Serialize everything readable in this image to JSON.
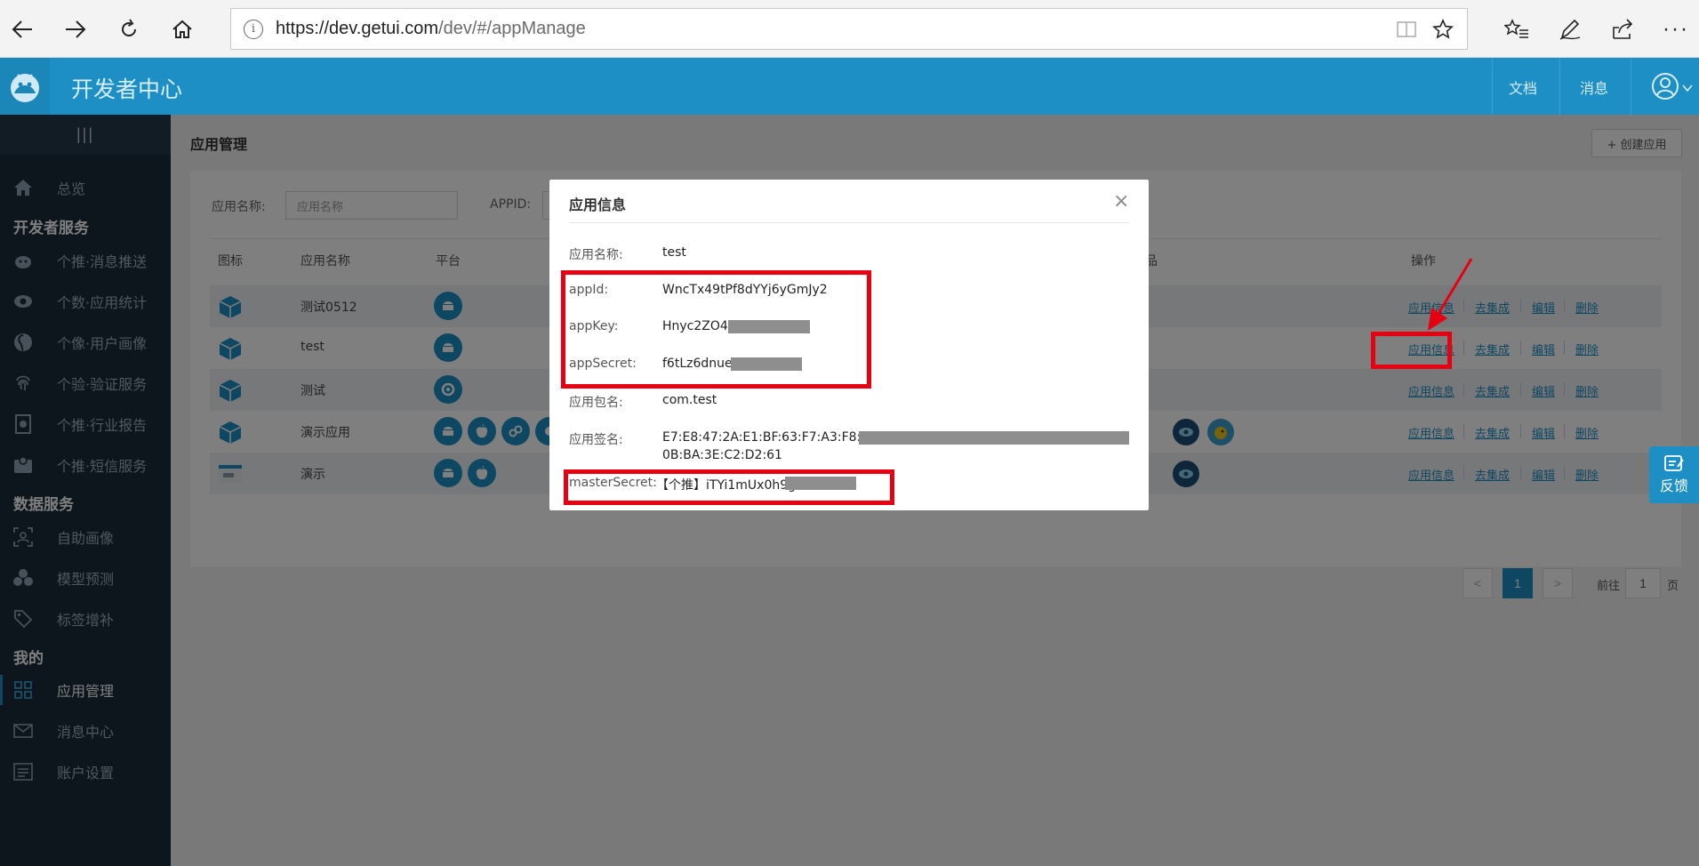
{
  "browser": {
    "url_host": "https://dev.getui.com",
    "url_path": "/dev/#/appManage"
  },
  "header": {
    "title": "开发者中心",
    "links": [
      "文档",
      "消息"
    ]
  },
  "sidebar": {
    "collapse_glyph": "|||",
    "sections": [
      "开发者服务",
      "数据服务",
      "我的"
    ],
    "items": [
      {
        "label": "总览",
        "icon": "home-icon"
      },
      {
        "label": "个推·消息推送",
        "icon": "push-icon"
      },
      {
        "label": "个数·应用统计",
        "icon": "eye-icon"
      },
      {
        "label": "个像·用户画像",
        "icon": "portrait-icon"
      },
      {
        "label": "个验·验证服务",
        "icon": "fingerprint-icon"
      },
      {
        "label": "个推·行业报告",
        "icon": "report-icon"
      },
      {
        "label": "个推·短信服务",
        "icon": "sms-icon"
      },
      {
        "label": "自助画像",
        "icon": "user-scan-icon"
      },
      {
        "label": "模型预测",
        "icon": "cubes-icon"
      },
      {
        "label": "标签增补",
        "icon": "tag-icon"
      },
      {
        "label": "应用管理",
        "icon": "grid-icon"
      },
      {
        "label": "消息中心",
        "icon": "mail-icon"
      },
      {
        "label": "账户设置",
        "icon": "settings-list-icon"
      }
    ]
  },
  "page": {
    "title": "应用管理",
    "create_button": "+ 创建应用",
    "filter": {
      "name_label": "应用名称:",
      "name_placeholder": "应用名称",
      "appid_label": "APPID:"
    },
    "table": {
      "headers": [
        "图标",
        "应用名称",
        "平台",
        "品",
        "操作"
      ],
      "rows": [
        {
          "name": "测试0512"
        },
        {
          "name": "test"
        },
        {
          "name": "测试"
        },
        {
          "name": "演示应用"
        },
        {
          "name": "演示"
        }
      ],
      "actions": [
        "应用信息",
        "去集成",
        "编辑",
        "删除"
      ]
    },
    "pagination": {
      "prev": "<",
      "current": "1",
      "next": ">",
      "goto_label": "前往",
      "goto_value": "1",
      "page_suffix": "页"
    }
  },
  "feedback": {
    "label": "反馈"
  },
  "modal": {
    "title": "应用信息",
    "close": "×",
    "fields": [
      {
        "label": "应用名称:",
        "value": "test"
      },
      {
        "label": "appId:",
        "value": "WncTx49tPf8dYYj6yGmJy2"
      },
      {
        "label": "appKey:",
        "value": "Hnyc2ZO4t0"
      },
      {
        "label": "appSecret:",
        "value": "f6tLz6dnue"
      },
      {
        "label": "应用包名:",
        "value": "com.test"
      },
      {
        "label": "应用签名:",
        "value": "E7:E8:47:2A:E1:BF:63:F7:A3:F8:D1:",
        "value2": "0B:BA:3E:C2:D2:61"
      },
      {
        "label": "masterSecret:",
        "value": "【个推】iTYi1mUx0h9gH"
      }
    ]
  },
  "colors": {
    "brand": "#1d8fc4",
    "sidebar": "#1b2b3a",
    "highlight": "#e60012"
  }
}
